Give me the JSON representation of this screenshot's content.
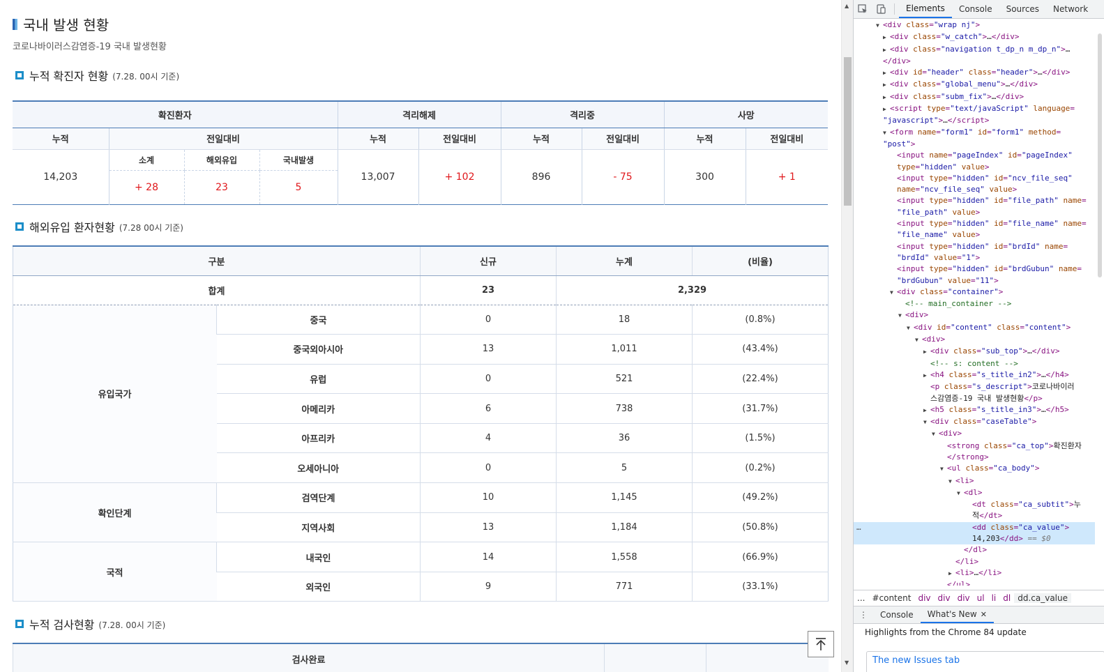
{
  "page": {
    "title": "국내 발생 현황",
    "description": "코로나바이러스감염증-19 국내 발생현황"
  },
  "section1": {
    "title": "누적 확진자 현황",
    "sub": "(7.28. 00시 기준)",
    "groups": [
      "확진환자",
      "격리해제",
      "격리중",
      "사망"
    ],
    "cum_label": "누적",
    "diff_label": "전일대비",
    "sub_cols": [
      "소계",
      "해외유입",
      "국내발생"
    ],
    "values": {
      "confirmed_total": "14,203",
      "confirmed_subtotal": "+ 28",
      "confirmed_imported": "23",
      "confirmed_domestic": "5",
      "released_total": "13,007",
      "released_diff": "+ 102",
      "isolated_total": "896",
      "isolated_diff": "- 75",
      "deaths_total": "300",
      "deaths_diff": "+ 1"
    }
  },
  "section2": {
    "title": "해외유입 환자현황",
    "sub": "(7.28 00시 기준)",
    "headers": [
      "구분",
      "신규",
      "누계",
      "(비율)"
    ],
    "sum": {
      "label": "합계",
      "new": "23",
      "total": "2,329"
    },
    "groups": [
      {
        "name": "유입국가",
        "rows": [
          {
            "label": "중국",
            "new": "0",
            "total": "18",
            "ratio": "(0.8%)"
          },
          {
            "label": "중국외아시아",
            "new": "13",
            "total": "1,011",
            "ratio": "(43.4%)"
          },
          {
            "label": "유럽",
            "new": "0",
            "total": "521",
            "ratio": "(22.4%)"
          },
          {
            "label": "아메리카",
            "new": "6",
            "total": "738",
            "ratio": "(31.7%)"
          },
          {
            "label": "아프리카",
            "new": "4",
            "total": "36",
            "ratio": "(1.5%)"
          },
          {
            "label": "오세아니아",
            "new": "0",
            "total": "5",
            "ratio": "(0.2%)"
          }
        ]
      },
      {
        "name": "확인단계",
        "rows": [
          {
            "label": "검역단계",
            "new": "10",
            "total": "1,145",
            "ratio": "(49.2%)"
          },
          {
            "label": "지역사회",
            "new": "13",
            "total": "1,184",
            "ratio": "(50.8%)"
          }
        ]
      },
      {
        "name": "국적",
        "rows": [
          {
            "label": "내국인",
            "new": "14",
            "total": "1,558",
            "ratio": "(66.9%)"
          },
          {
            "label": "외국인",
            "new": "9",
            "total": "771",
            "ratio": "(33.1%)"
          }
        ]
      }
    ]
  },
  "section3": {
    "title": "누적 검사현황",
    "sub": "(7.28. 00시 기준)",
    "header1": "검사완료"
  },
  "devtools": {
    "tabs": [
      "Elements",
      "Console",
      "Sources",
      "Network"
    ],
    "breadcrumbs": [
      "...",
      "#content",
      "div",
      "div",
      "div",
      "ul",
      "li",
      "dl",
      "dd.ca_value"
    ],
    "drawer_tabs": [
      "Console",
      "What's New"
    ],
    "whats_new_text": "Highlights from the Chrome 84 update",
    "card_title": "The new Issues tab",
    "dom_lines": [
      {
        "i": 0,
        "t": "open",
        "h": "<span class='an'>class</span>=<span class='av'>\"wrap nj\"</span>",
        "tag": "div"
      }
    ]
  },
  "colors": {
    "accent_blue": "#4c7cb6",
    "red": "#e0171b",
    "devtools_blue": "#1a73e8"
  },
  "icons": [
    "section-box-icon",
    "scroll-top-icon",
    "inspect-icon",
    "device-icon",
    "kebab-icon",
    "close-icon"
  ]
}
